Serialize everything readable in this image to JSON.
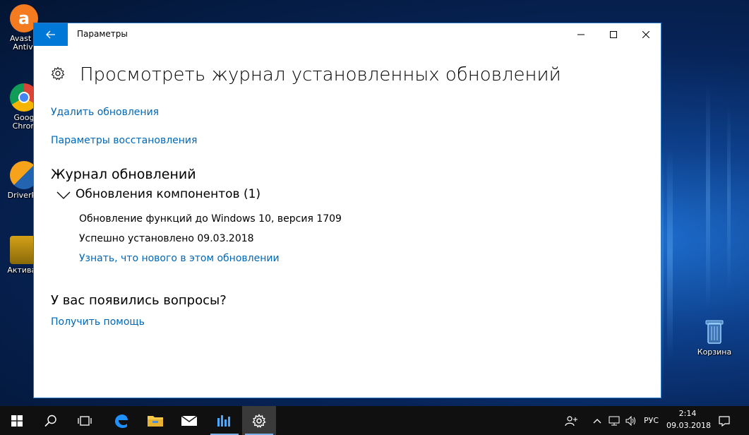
{
  "desktop": {
    "icons": [
      {
        "label_line1": "Avast F",
        "label_line2": "Antivi"
      },
      {
        "label_line1": "Goog",
        "label_line2": "Chron"
      },
      {
        "label_line1": "DriverPa",
        "label_line2": ""
      },
      {
        "label_line1": "Активат",
        "label_line2": ""
      }
    ],
    "recycle_bin_label": "Корзина"
  },
  "window": {
    "title": "Параметры",
    "page_title": "Просмотреть журнал установленных обновлений",
    "link_uninstall": "Удалить обновления",
    "link_recovery": "Параметры восстановления",
    "section_history": "Журнал обновлений",
    "group_title": "Обновления компонентов (1)",
    "update_name": "Обновление функций до Windows 10, версия 1709",
    "update_status": "Успешно установлено 09.03.2018",
    "update_link": "Узнать, что нового в этом обновлении",
    "questions_title": "У вас появились вопросы?",
    "help_link": "Получить помощь"
  },
  "taskbar": {
    "language": "РУС",
    "time": "2:14",
    "date": "09.03.2018"
  },
  "colors": {
    "accent": "#0078d7",
    "link": "#0067b8",
    "taskbar": "#101010"
  }
}
